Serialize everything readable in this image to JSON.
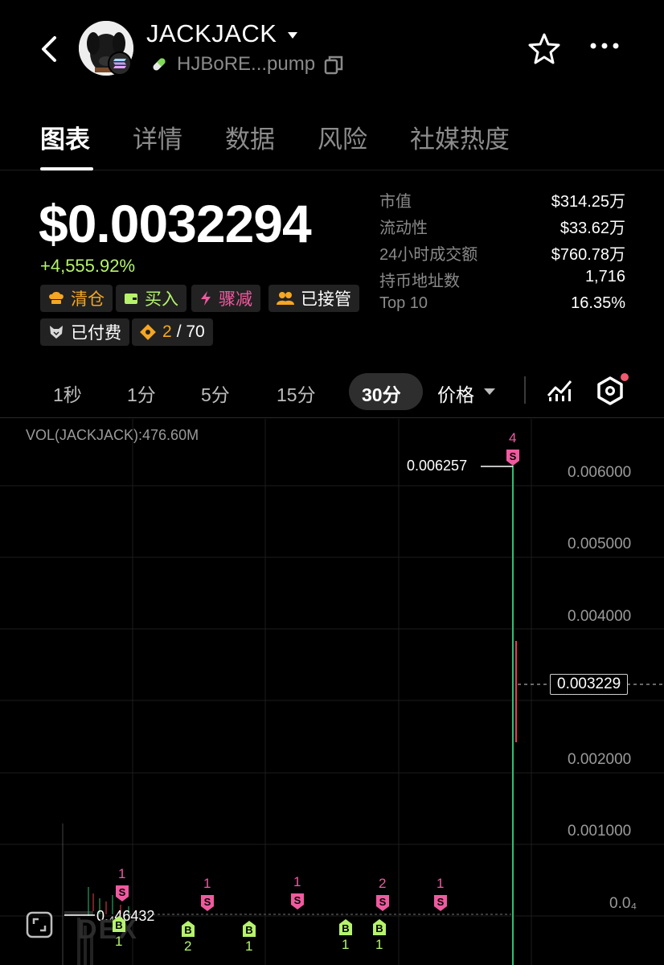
{
  "header": {
    "token_name": "JACKJACK",
    "address": "HJBoRE...pump"
  },
  "tabs": [
    {
      "label": "图表",
      "active": true
    },
    {
      "label": "详情"
    },
    {
      "label": "数据"
    },
    {
      "label": "风险"
    },
    {
      "label": "社媒热度"
    }
  ],
  "price": {
    "value": "$0.0032294",
    "change": "+4,555.92%"
  },
  "tags": [
    {
      "label": "清仓",
      "color": "#f5a623"
    },
    {
      "label": "买入",
      "color": "#b6f36c"
    },
    {
      "label": "骤减",
      "color": "#ef5a9f"
    },
    {
      "label": "已接管",
      "color": "#ffffff"
    },
    {
      "label": "已付费",
      "color": "#ffffff"
    },
    {
      "label": "2",
      "suffix": "/ 70",
      "color": "#f5a623"
    }
  ],
  "stats": [
    {
      "label": "市值",
      "value": "$314.25万"
    },
    {
      "label": "流动性",
      "value": "$33.62万"
    },
    {
      "label": "24小时成交额",
      "value": "$760.78万"
    },
    {
      "label": "持币地址数",
      "value": "1,716"
    },
    {
      "label": "Top 10",
      "value": "16.35%"
    }
  ],
  "timeframes": [
    "1秒",
    "1分",
    "5分",
    "15分"
  ],
  "timeframe_active": "30分",
  "price_toggle": "价格",
  "chart": {
    "vol_label": "VOL(JACKJACK):476.60M",
    "axis": [
      "0.006000",
      "0.005000",
      "0.004000",
      "0.002000",
      "0.001000",
      "0.0₄"
    ],
    "high_label": "0.006257",
    "low_label": "0.₄46432",
    "current_flag": "0.003229",
    "watermark": "DEX",
    "markers": [
      {
        "type": "S",
        "count": "1"
      },
      {
        "type": "B",
        "count": "1"
      },
      {
        "type": "B",
        "count": "2"
      },
      {
        "type": "S",
        "count": "1"
      },
      {
        "type": "B",
        "count": "1"
      },
      {
        "type": "S",
        "count": "1"
      },
      {
        "type": "B",
        "count": "1"
      },
      {
        "type": "S",
        "count": "2"
      },
      {
        "type": "B",
        "count": "1"
      },
      {
        "type": "S",
        "count": "1"
      },
      {
        "type": "S",
        "count": "4"
      }
    ],
    "colors": {
      "sell": "#ef5a9f",
      "buy": "#b6f36c",
      "up": "#2fbf71",
      "down": "#ef3b4d"
    }
  }
}
